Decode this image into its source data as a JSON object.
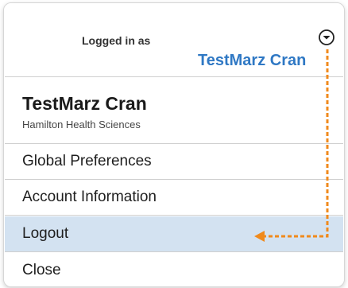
{
  "header": {
    "logged_in_label": "Logged in as",
    "user_name": "TestMarz Cran",
    "toggle_icon": "chevron-down-circle-icon"
  },
  "menu": {
    "user_name": "TestMarz Cran",
    "organization": "Hamilton Health Sciences",
    "items": [
      {
        "label": "Global Preferences"
      },
      {
        "label": "Account Information"
      },
      {
        "label": "Logout",
        "highlighted": true
      },
      {
        "label": "Close"
      }
    ]
  },
  "colors": {
    "header_name": "#2f78c4",
    "highlight_row": "#d3e2f1",
    "annotation_arrow": "#f08a1c"
  }
}
